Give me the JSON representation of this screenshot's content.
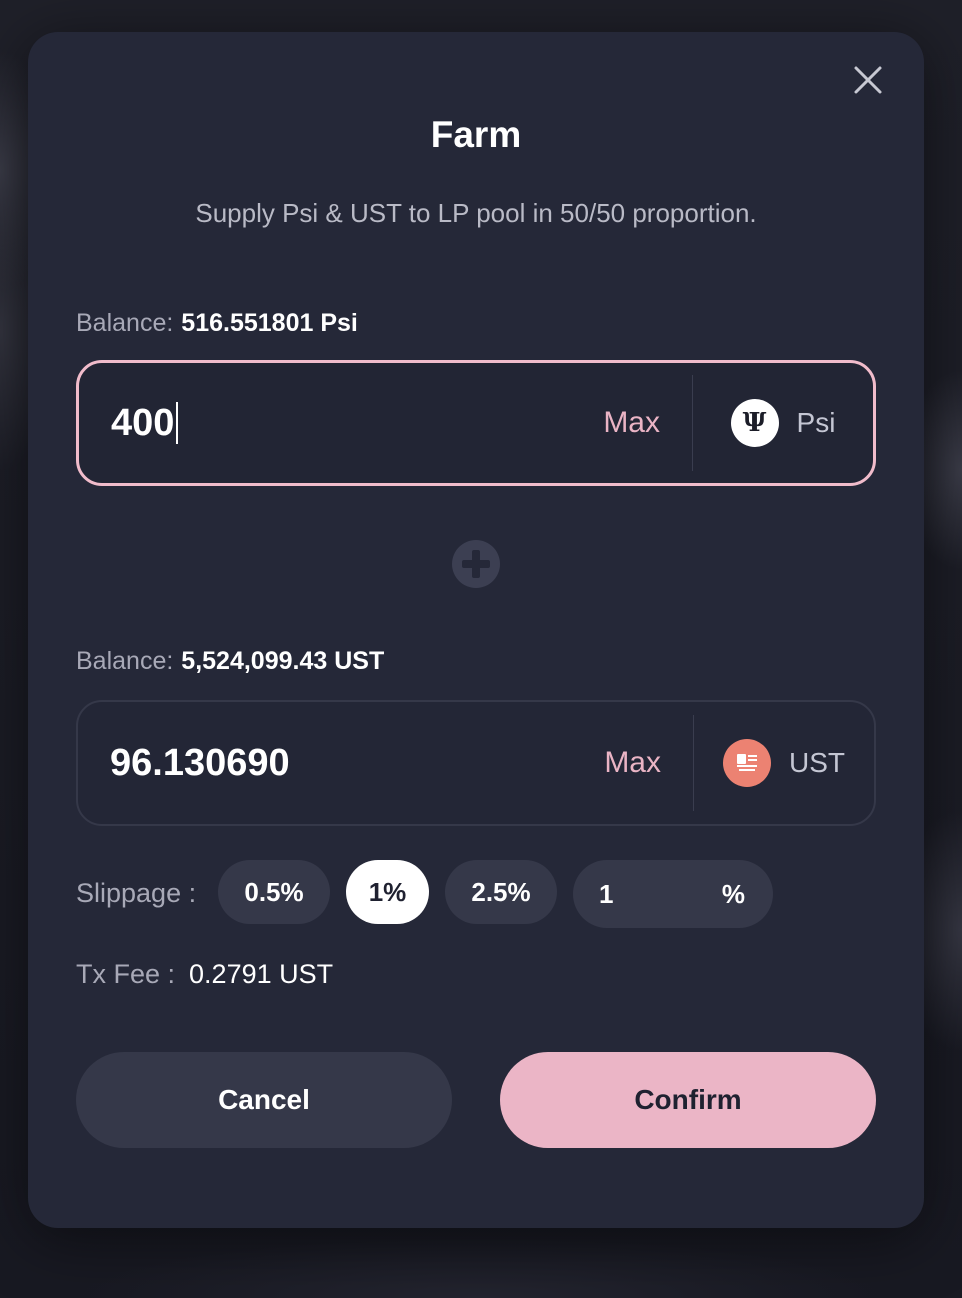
{
  "modal": {
    "title": "Farm",
    "subtitle": "Supply Psi & UST to LP pool in 50/50 proportion."
  },
  "psi": {
    "balance_label": "Balance:",
    "balance_value": "516.551801 Psi",
    "amount": "400",
    "max_label": "Max",
    "token": "Psi"
  },
  "ust": {
    "balance_label": "Balance:",
    "balance_value": "5,524,099.43 UST",
    "amount": "96.130690",
    "max_label": "Max",
    "token": "UST"
  },
  "slippage": {
    "label": "Slippage :",
    "options": [
      "0.5%",
      "1%",
      "2.5%"
    ],
    "selected": "1%",
    "custom_value": "1",
    "custom_unit": "%"
  },
  "fee": {
    "label": "Tx Fee :",
    "value": "0.2791 UST"
  },
  "buttons": {
    "cancel": "Cancel",
    "confirm": "Confirm"
  },
  "colors": {
    "accent": "#ebb5c6",
    "modal_bg": "#252838",
    "ust_icon": "#ec8272"
  },
  "icons": {
    "close": "close-icon",
    "psi": "psi-token-icon",
    "ust": "ust-token-icon",
    "plus": "plus-icon"
  }
}
